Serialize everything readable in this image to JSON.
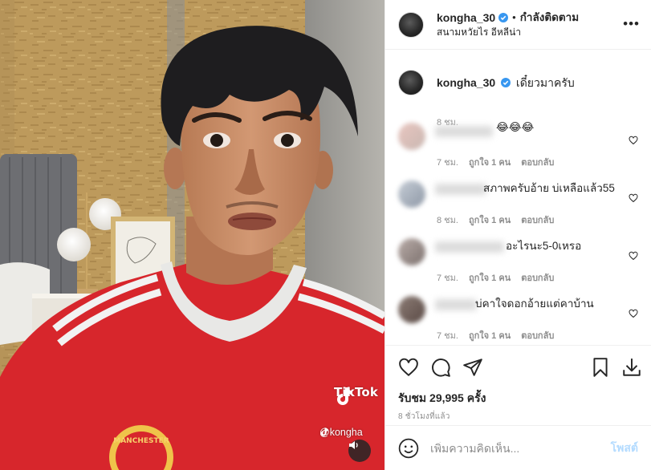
{
  "post": {
    "username": "kongha_30",
    "follow_status": "กำลังติดตาม",
    "separator": "•",
    "location": "สนามหวัยไร อีหลีน่า",
    "caption": "เดี๋ยวมาครับ",
    "caption_time": "8 ชม.",
    "likes": "รับชม 29,995 ครั้ง",
    "posted_ago": "8 ชั่วโมงที่แล้ว"
  },
  "media": {
    "watermark_brand": "TikTok",
    "watermark_handle": "@kongha",
    "jersey_crest_text": "MANCHESTER"
  },
  "comments": [
    {
      "text": "😂😂😂",
      "time": "7 ชม.",
      "likes": "ถูกใจ 1 คน",
      "reply": "ตอบกลับ"
    },
    {
      "text": "สภาพครับอ้าย บ่เหลือแล้ว55",
      "time": "8 ชม.",
      "likes": "ถูกใจ 1 คน",
      "reply": "ตอบกลับ"
    },
    {
      "text": "อะไรนะ5-0เหรอ",
      "time": "7 ชม.",
      "likes": "ถูกใจ 1 คน",
      "reply": "ตอบกลับ"
    },
    {
      "text": "บ่คาใจดอกอ้ายแต่คาบ้าน",
      "time": "7 ชม.",
      "likes": "ถูกใจ 1 คน",
      "reply": "ตอบกลับ"
    }
  ],
  "composer": {
    "placeholder": "เพิ่มความคิดเห็น...",
    "post_label": "โพสต์"
  },
  "icons": {
    "like": "heart-icon",
    "comment": "comment-icon",
    "share": "share-icon",
    "save": "bookmark-icon",
    "download": "download-icon",
    "emoji": "emoji-icon",
    "more": "more-icon",
    "verified": "verified-badge-icon",
    "sound": "sound-on-icon"
  },
  "colors": {
    "verified_blue": "#3897f0",
    "post_button_disabled": "#b3dbff",
    "meta_gray": "#8e8e8e",
    "jersey_red": "#d7262c"
  }
}
